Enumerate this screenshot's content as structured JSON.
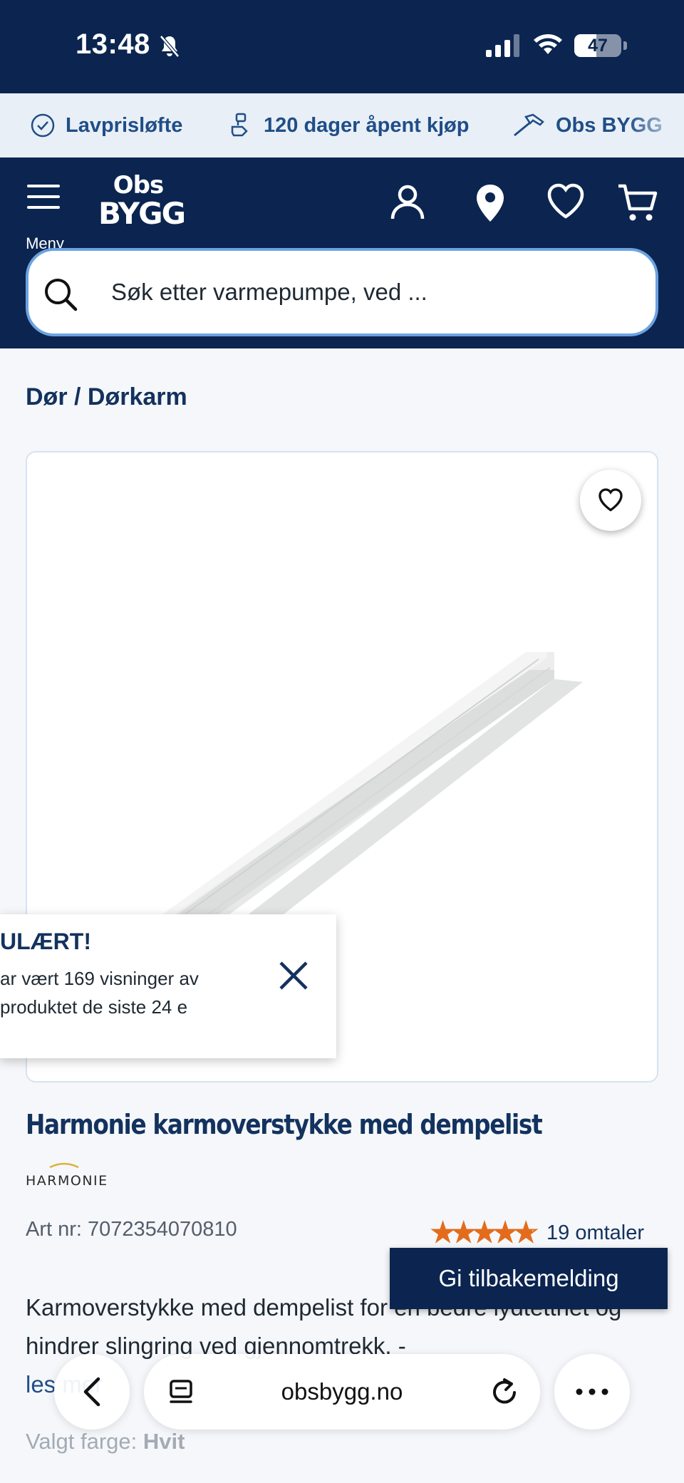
{
  "status_bar": {
    "time": "13:48",
    "battery": "47",
    "battery_level": 0.47
  },
  "usp_bar": {
    "items": [
      "Lavprisløfte",
      "120 dager åpent kjøp",
      "Obs BYGG"
    ]
  },
  "header": {
    "menu_label": "Meny",
    "logo_top": "Obs",
    "logo_bottom": "BYGG",
    "search_placeholder": "Søk etter varmepumpe, ved ..."
  },
  "breadcrumb": "Dør / Dørkarm",
  "toast": {
    "title": "ULÆRT!",
    "text": "ar vært 169 visninger av produktet de siste 24 e"
  },
  "product": {
    "title": "Harmonie karmoverstykke med dempelist",
    "brand": "HARMONIE",
    "art_nr": "Art nr: 7072354070810",
    "rating": 4.5,
    "rating_max": 5,
    "reviews": "19 omtaler",
    "description": "Karmoverstykke med dempelist for en bedre lydtetthet og hindrer slingring ved gjennomtrekk. -",
    "read_more": "les mer",
    "color_label": "Valgt farge:",
    "color_value": "Hvit",
    "colors": {
      "star": "#e36c1c",
      "navy": "#0b2550"
    }
  },
  "feedback_button": "Gi tilbakemelding",
  "browser": {
    "url": "obsbygg.no"
  }
}
